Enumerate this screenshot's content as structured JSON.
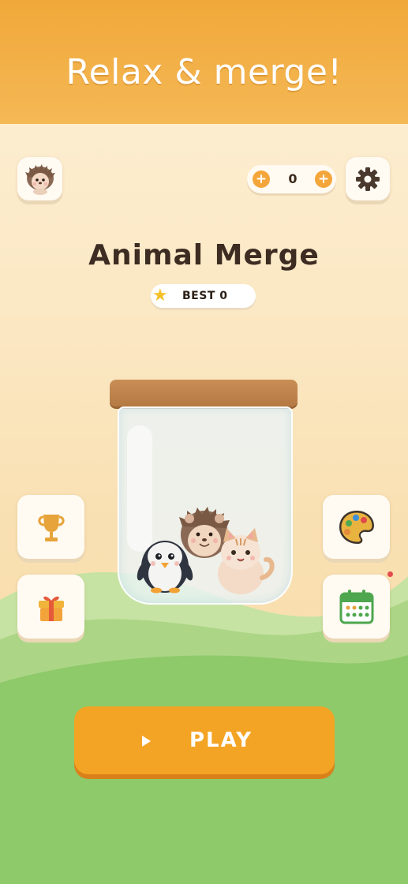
{
  "banner": {
    "title": "Relax & merge!"
  },
  "header": {
    "coins": "0"
  },
  "game": {
    "title": "Animal Merge",
    "best_label": "BEST 0"
  },
  "play_button": {
    "label": "PLAY"
  },
  "jar": {
    "animals": [
      "penguin",
      "hedgehog",
      "cat"
    ]
  },
  "icons": {
    "avatar": "hedgehog-avatar-icon",
    "settings": "gear-icon",
    "coin_left": "coin-icon",
    "coin_add": "plus-icon",
    "best": "star-icon",
    "trophy": "trophy-icon",
    "gift": "gift-icon",
    "palette": "palette-icon",
    "calendar": "calendar-icon",
    "play": "play-icon"
  },
  "colors": {
    "accent": "#f4a425",
    "banner": "#f1a83a",
    "title_text": "#3d2c22",
    "hill_green": "#8ec96a"
  }
}
